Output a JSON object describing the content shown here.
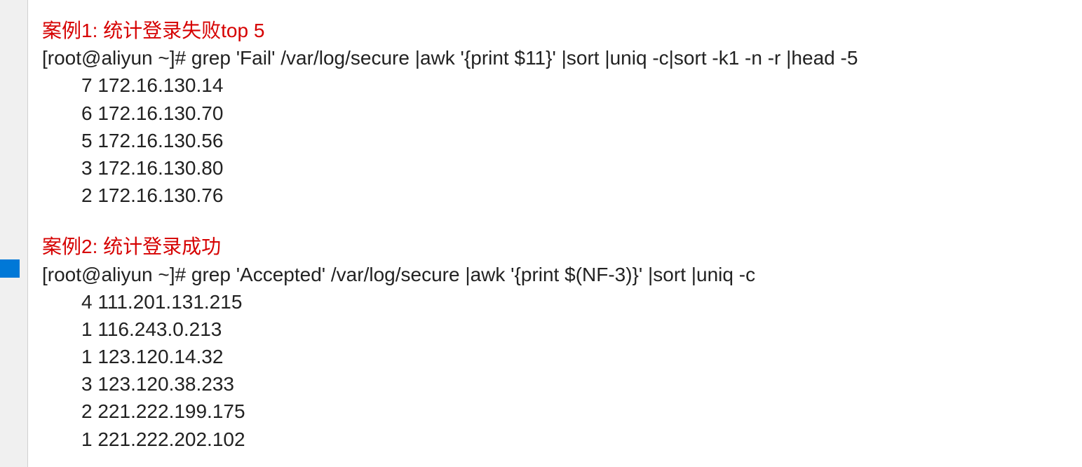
{
  "case1": {
    "title": "案例1: 统计登录失败top 5",
    "command": "[root@aliyun ~]# grep 'Fail' /var/log/secure |awk '{print $11}' |sort |uniq -c|sort -k1 -n -r |head -5",
    "rows": [
      "7 172.16.130.14",
      "6 172.16.130.70",
      "5 172.16.130.56",
      "3 172.16.130.80",
      "2 172.16.130.76"
    ]
  },
  "case2": {
    "title": "案例2: 统计登录成功",
    "command": "[root@aliyun ~]# grep 'Accepted' /var/log/secure |awk '{print $(NF-3)}' |sort |uniq -c",
    "rows": [
      "4 111.201.131.215",
      "1 116.243.0.213",
      "1 123.120.14.32",
      "3 123.120.38.233",
      "2 221.222.199.175",
      "1 221.222.202.102"
    ]
  }
}
